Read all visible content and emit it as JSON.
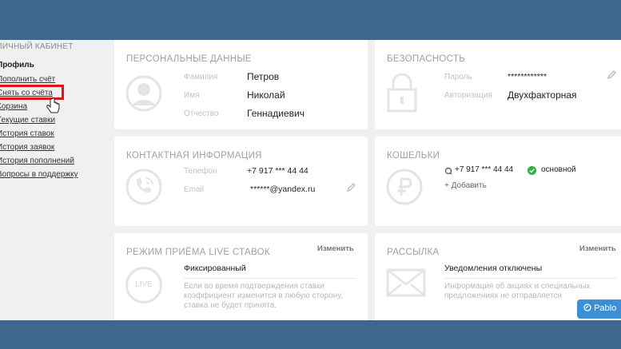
{
  "sidebar": {
    "heading": "ЛИЧНЫЙ КАБИНЕТ",
    "items": [
      {
        "label": "Профиль"
      },
      {
        "label": "Пополнить счёт"
      },
      {
        "label": "Снять со счёта"
      },
      {
        "label": "Корзина"
      },
      {
        "label": "Текущие ставки"
      },
      {
        "label": "История ставок"
      },
      {
        "label": "История заявок"
      },
      {
        "label": "История пополнений"
      },
      {
        "label": "Вопросы в поддержку"
      }
    ]
  },
  "personal": {
    "title": "ПЕРСОНАЛЬНЫЕ ДАННЫЕ",
    "fields": [
      {
        "label": "Фамилия",
        "value": "Петров"
      },
      {
        "label": "Имя",
        "value": "Николай"
      },
      {
        "label": "Отчество",
        "value": "Геннадиевич"
      }
    ]
  },
  "security": {
    "title": "БЕЗОПАСНОСТЬ",
    "fields": [
      {
        "label": "Пароль",
        "value": "************"
      },
      {
        "label": "Авторизация",
        "value": "Двухфакторная"
      }
    ]
  },
  "contact": {
    "title": "КОНТАКТНАЯ ИНФОРМАЦИЯ",
    "fields": [
      {
        "label": "Телефон",
        "value": "+7 917 *** 44 44"
      },
      {
        "label": "Email",
        "value": "******@yandex.ru"
      }
    ]
  },
  "wallets": {
    "title": "КОШЕЛЬКИ",
    "phone": "+7 917 *** 44 44",
    "badge": "основной",
    "add": "+ Добавить"
  },
  "live_mode": {
    "title": "РЕЖИМ ПРИЁМА LIVE СТАВОК",
    "action": "Изменить",
    "icon_text": "LIVE",
    "value": "Фиксированный",
    "note": "Если во время подтверждения ставки коэффициент изменится в любую сторону, ставка не будет принята."
  },
  "mailing": {
    "title": "РАССЫЛКА",
    "action": "Изменить",
    "value": "Уведомления отключены",
    "note": "Информация об акциях и специальных предложениях не отправляется"
  },
  "chat_button": {
    "label": "Pablo"
  },
  "colors": {
    "accent": "#3b8fd6",
    "highlight": "#e0121b",
    "success": "#2fb24a",
    "backdrop": "#3f668d"
  }
}
